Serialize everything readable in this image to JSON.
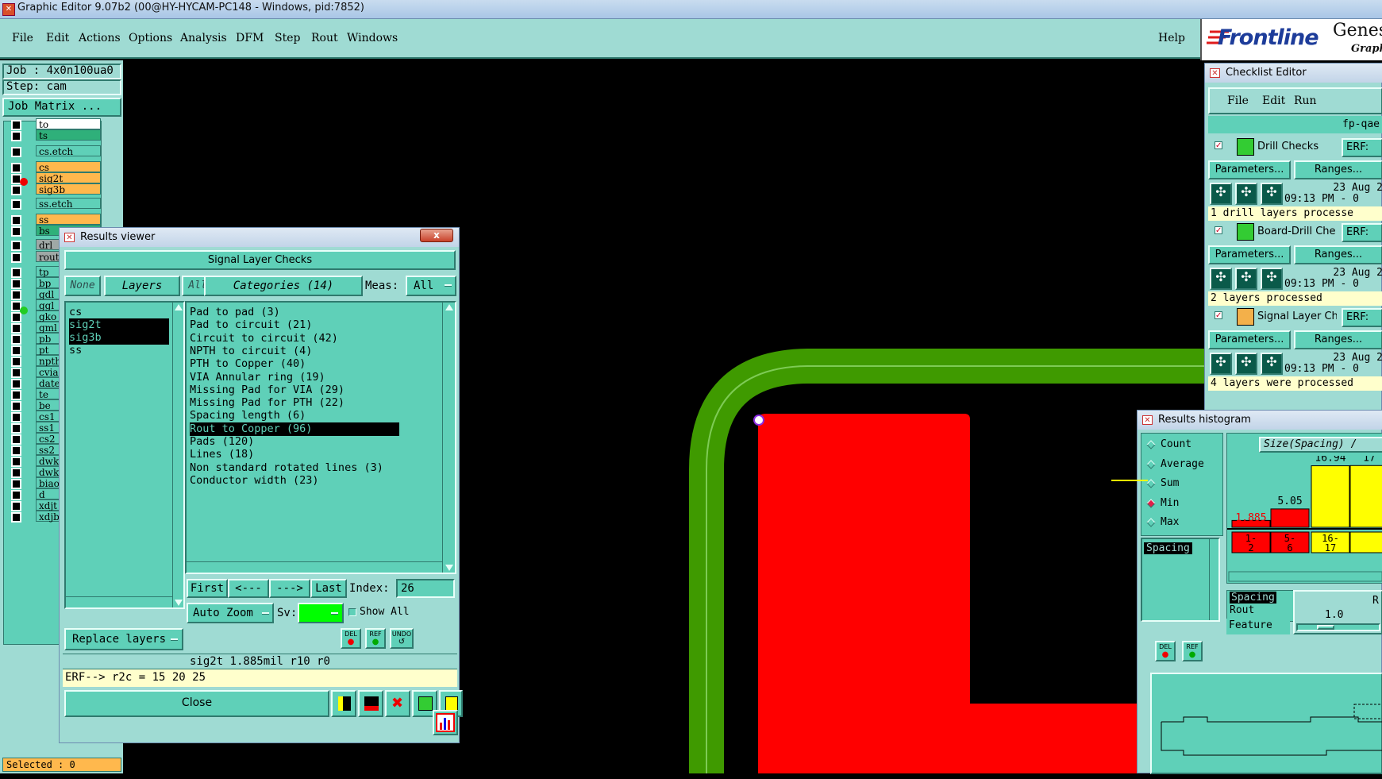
{
  "window": {
    "title": "Graphic Editor 9.07b2 (00@HY-HYCAM-PC148 - Windows, pid:7852)"
  },
  "menu": {
    "items": [
      "File",
      "Edit",
      "Actions",
      "Options",
      "Analysis",
      "DFM",
      "Step",
      "Rout",
      "Windows"
    ],
    "help": "Help"
  },
  "logo": {
    "brand": "Frontline",
    "product": "Genes",
    "sub": "Graphi"
  },
  "job": {
    "job_line": "Job : 4x0n100ua0",
    "step_line": "Step: cam",
    "matrix_button": "Job Matrix ..."
  },
  "layers": [
    {
      "name": "to",
      "bg": "#ffffff"
    },
    {
      "name": "ts",
      "bg": "#2fb07a"
    },
    {
      "name": "cs.etch",
      "bg": "#5fd0b8"
    },
    {
      "name": "cs",
      "bg": "#ffb84d"
    },
    {
      "name": "sig2t",
      "bg": "#ffb84d"
    },
    {
      "name": "sig3b",
      "bg": "#ffb84d"
    },
    {
      "name": "ss.etch",
      "bg": "#5fd0b8"
    },
    {
      "name": "ss",
      "bg": "#ffb84d"
    },
    {
      "name": "bs",
      "bg": "#2fb07a"
    },
    {
      "name": "drl",
      "bg": "#9fa8a6"
    },
    {
      "name": "rout",
      "bg": "#9fa8a6"
    },
    {
      "name": "tp",
      "bg": "#5fd0b8"
    },
    {
      "name": "bp",
      "bg": "#5fd0b8"
    },
    {
      "name": "gdl",
      "bg": "#5fd0b8"
    },
    {
      "name": "ggl",
      "bg": "#5fd0b8"
    },
    {
      "name": "gko",
      "bg": "#5fd0b8"
    },
    {
      "name": "gml",
      "bg": "#5fd0b8"
    },
    {
      "name": "pb",
      "bg": "#5fd0b8"
    },
    {
      "name": "pt",
      "bg": "#5fd0b8"
    },
    {
      "name": "npth",
      "bg": "#5fd0b8"
    },
    {
      "name": "cvia",
      "bg": "#5fd0b8"
    },
    {
      "name": "date",
      "bg": "#5fd0b8"
    },
    {
      "name": "te",
      "bg": "#5fd0b8"
    },
    {
      "name": "be",
      "bg": "#5fd0b8"
    },
    {
      "name": "cs1",
      "bg": "#5fd0b8"
    },
    {
      "name": "ss1",
      "bg": "#5fd0b8"
    },
    {
      "name": "cs2",
      "bg": "#5fd0b8"
    },
    {
      "name": "ss2",
      "bg": "#5fd0b8"
    },
    {
      "name": "dwk",
      "bg": "#5fd0b8"
    },
    {
      "name": "dwkb",
      "bg": "#5fd0b8"
    },
    {
      "name": "biao",
      "bg": "#5fd0b8"
    },
    {
      "name": "d",
      "bg": "#5fd0b8"
    },
    {
      "name": "xdjt",
      "bg": "#5fd0b8"
    },
    {
      "name": "xdjb",
      "bg": "#5fd0b8"
    }
  ],
  "selected": "Selected : 0",
  "results_viewer": {
    "title": "Results viewer",
    "close_x": "x",
    "section": "Signal Layer Checks",
    "none_btn": "None",
    "layers_btn": "Layers",
    "all_btn": "All",
    "categories_btn": "Categories (14)",
    "meas_label": "Meas:",
    "meas_value": "All",
    "layer_list": [
      "cs",
      "sig2t",
      "sig3b",
      "ss"
    ],
    "categories": [
      "Pad to pad (3)",
      "Pad to circuit (21)",
      "Circuit to circuit (42)",
      "NPTH to circuit (4)",
      "PTH to Copper (40)",
      "VIA Annular ring (19)",
      "Missing Pad for VIA (29)",
      "Missing Pad for PTH (22)",
      "Spacing length (6)",
      "Rout to Copper (96)",
      "Pads (120)",
      "Lines (18)",
      "Non standard rotated lines (3)",
      "Conductor width (23)"
    ],
    "first": "First",
    "prev": "<---",
    "next": "--->",
    "last": "Last",
    "index_label": "Index:",
    "index_value": "26",
    "auto_zoom": "Auto Zoom",
    "sv_label": "Sv:",
    "show_all": "Show All",
    "replace_layers": "Replace layers",
    "del": "DEL",
    "ref": "REF",
    "undo": "UNDO",
    "status": "sig2t 1.885mil   r10   r0",
    "erf": "ERF--> r2c = 15 20 25",
    "close": "Close"
  },
  "checklist": {
    "title": "Checklist Editor",
    "menu": [
      "File",
      "Edit",
      "Run"
    ],
    "name": "fp-qae",
    "items": [
      {
        "name": "Drill Checks",
        "erf": "ERF:",
        "params": "Parameters...",
        "ranges": "Ranges...",
        "date": "23 Aug 2",
        "time": "09:13 PM - 0",
        "msg": "1 drill layers processe"
      },
      {
        "name": "Board-Drill Che",
        "erf": "ERF:",
        "params": "Parameters...",
        "ranges": "Ranges...",
        "date": "23 Aug 2",
        "time": "09:13 PM - 0",
        "msg": "2 layers processed"
      },
      {
        "name": "Signal Layer Ch",
        "erf": "ERF:",
        "params": "Parameters...",
        "ranges": "Ranges...",
        "date": "23 Aug 2",
        "time": "09:13 PM - 0",
        "msg": "4 layers were processed"
      }
    ]
  },
  "histogram": {
    "title": "Results histogram",
    "options": [
      "Count",
      "Average",
      "Sum",
      "Min",
      "Max"
    ],
    "selected_option": "Min",
    "size_label": "Size(Spacing) /",
    "list": [
      "Spacing"
    ],
    "bars": [
      {
        "label": "1.885",
        "bin": "1-\n2",
        "color": "#ff0000",
        "value": 1.885
      },
      {
        "label": "5.05",
        "bin": "5-\n6",
        "color": "#ff0000",
        "value": 5.05
      },
      {
        "label": "16.94",
        "bin": "16-\n17",
        "color": "#ffff00",
        "value": 16.94
      },
      {
        "label": "17",
        "bin": "",
        "color": "#ffff00",
        "value": 17
      }
    ],
    "bottom_list": [
      "Spacing",
      "Rout",
      "Feature"
    ],
    "r_label": "R",
    "scale_value": "1.0",
    "del": "DEL",
    "ref": "REF"
  }
}
